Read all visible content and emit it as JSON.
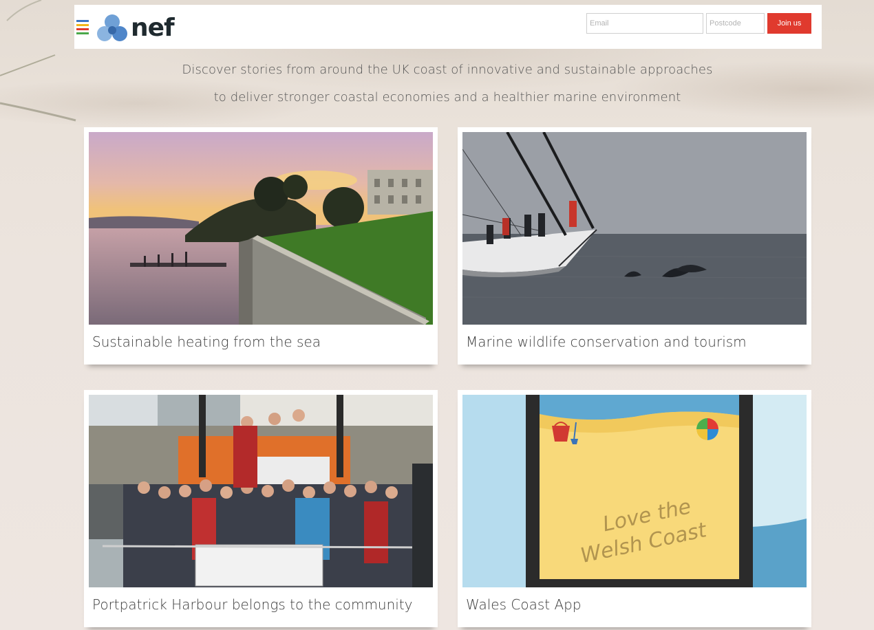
{
  "brand": {
    "logo_text": "nef",
    "accent": "#e03a2e"
  },
  "header": {
    "email_placeholder": "Email",
    "postcode_placeholder": "Postcode",
    "join_label": "Join us",
    "menu_icon": "hamburger-icon"
  },
  "intro": {
    "line1": "Discover stories from around the UK coast of innovative and sustainable approaches",
    "line2": "to deliver stronger coastal economies and a healthier marine environment"
  },
  "cards": [
    {
      "title": "Sustainable heating from the sea",
      "image": "harbour-sunset-photo"
    },
    {
      "title": "Marine wildlife conservation and tourism",
      "image": "sailing-dolphins-photo"
    },
    {
      "title": "Portpatrick Harbour belongs to the community",
      "image": "harbour-group-photo"
    },
    {
      "title": "Wales Coast App",
      "image": "love-the-welsh-coast-illustration",
      "illustration_text": "Love the\nWelsh Coast"
    }
  ]
}
